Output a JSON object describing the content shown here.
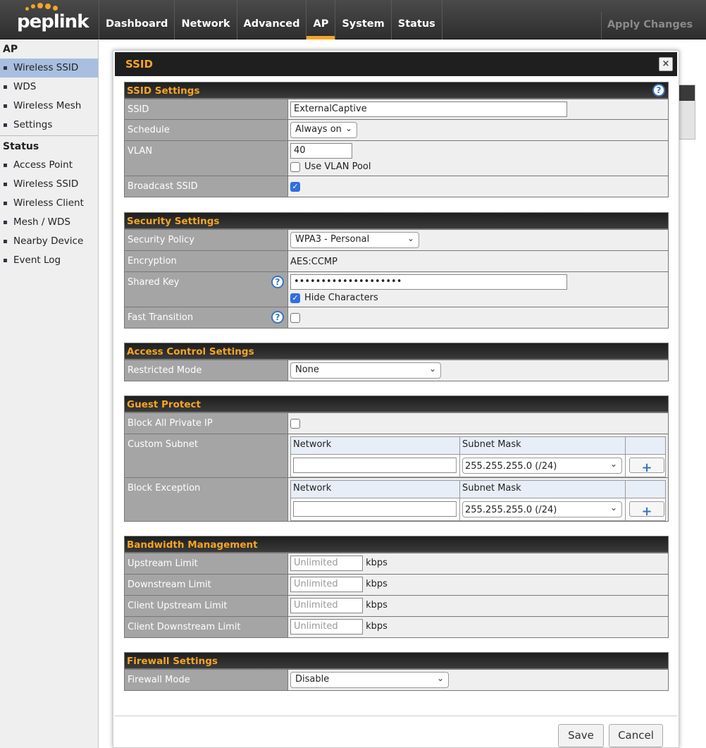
{
  "brand": {
    "logo_text": "peplink",
    "accent": "#f5a623"
  },
  "nav": {
    "tabs": [
      "Dashboard",
      "Network",
      "Advanced",
      "AP",
      "System",
      "Status"
    ],
    "active": "AP",
    "apply_label": "Apply Changes"
  },
  "sidebar": {
    "section1": "AP",
    "items1": [
      "Wireless SSID",
      "WDS",
      "Wireless Mesh",
      "Settings"
    ],
    "section2": "Status",
    "items2": [
      "Access Point",
      "Wireless SSID",
      "Wireless Client",
      "Mesh / WDS",
      "Nearby Device",
      "Event Log"
    ],
    "active_item": "Wireless SSID"
  },
  "modal": {
    "title": "SSID",
    "close_glyph": "×",
    "help_glyph": "?",
    "ssid_settings": {
      "heading": "SSID Settings",
      "ssid_label": "SSID",
      "ssid_value": "ExternalCaptive",
      "schedule_label": "Schedule",
      "schedule_value": "Always on",
      "vlan_label": "VLAN",
      "vlan_value": "40",
      "vlan_pool_label": "Use VLAN Pool",
      "broadcast_label": "Broadcast SSID"
    },
    "security": {
      "heading": "Security Settings",
      "policy_label": "Security Policy",
      "policy_value": "WPA3 - Personal",
      "encryption_label": "Encryption",
      "encryption_value": "AES:CCMP",
      "key_label": "Shared Key",
      "key_value": "••••••••••••••••••••",
      "hide_label": "Hide Characters",
      "fast_label": "Fast Transition"
    },
    "access": {
      "heading": "Access Control Settings",
      "restricted_label": "Restricted Mode",
      "restricted_value": "None"
    },
    "guest": {
      "heading": "Guest Protect",
      "block_label": "Block All Private IP",
      "custom_label": "Custom Subnet",
      "exception_label": "Block Exception",
      "col_network": "Network",
      "col_mask": "Subnet Mask",
      "mask_value": "255.255.255.0 (/24)",
      "plus_glyph": "+"
    },
    "bandwidth": {
      "heading": "Bandwidth Management",
      "rows": [
        {
          "label": "Upstream Limit",
          "placeholder": "Unlimited",
          "unit": "kbps"
        },
        {
          "label": "Downstream Limit",
          "placeholder": "Unlimited",
          "unit": "kbps"
        },
        {
          "label": "Client Upstream Limit",
          "placeholder": "Unlimited",
          "unit": "kbps"
        },
        {
          "label": "Client Downstream Limit",
          "placeholder": "Unlimited",
          "unit": "kbps"
        }
      ]
    },
    "firewall": {
      "heading": "Firewall Settings",
      "mode_label": "Firewall Mode",
      "mode_value": "Disable"
    },
    "save_label": "Save",
    "cancel_label": "Cancel"
  }
}
